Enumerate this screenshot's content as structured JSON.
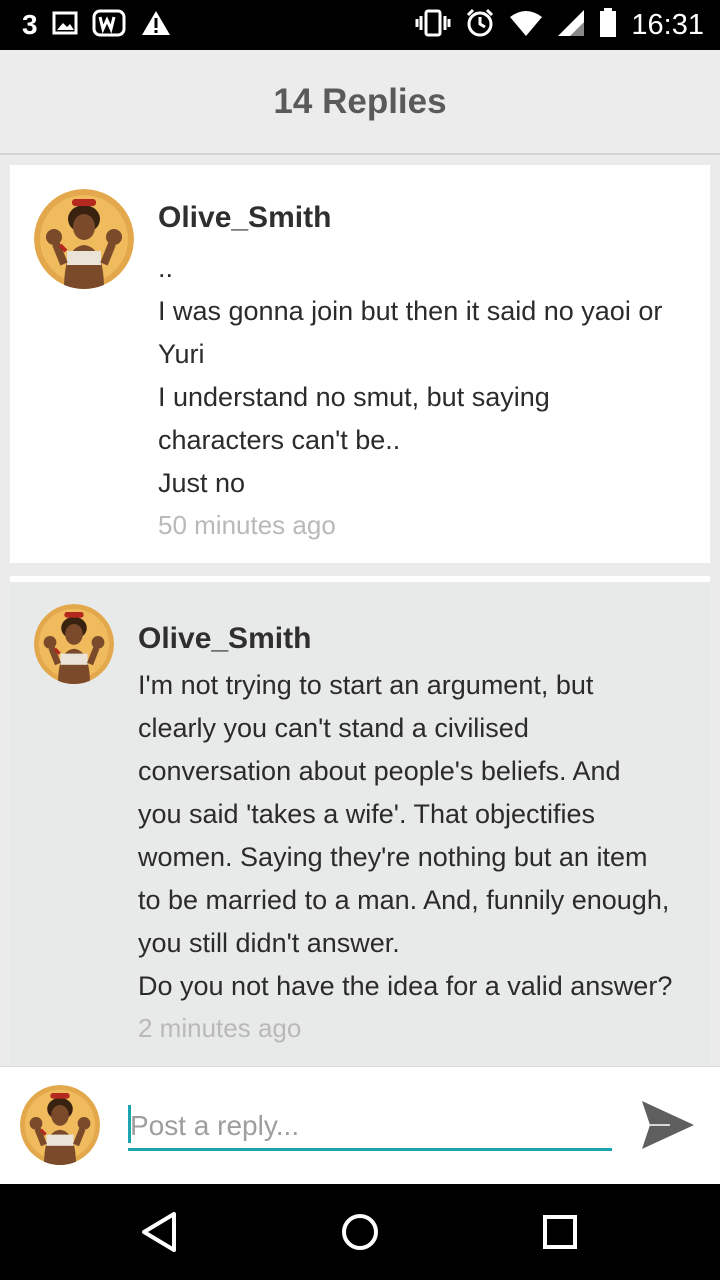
{
  "status_bar": {
    "notification_count": "3",
    "time": "16:31",
    "icons": [
      "image-icon",
      "w-app-icon",
      "warning-icon",
      "vibrate-icon",
      "alarm-icon",
      "wifi-icon",
      "signal-icon",
      "battery-icon"
    ]
  },
  "header": {
    "title": "14 Replies"
  },
  "replies": [
    {
      "username": "Olive_Smith",
      "lines": [
        "..",
        "I was gonna join but then it said no yaoi or",
        "Yuri",
        "I understand no smut, but saying",
        "characters can't be..",
        "Just no"
      ],
      "timestamp": "50 minutes ago"
    },
    {
      "username": "Olive_Smith",
      "lines": [
        "I'm not trying to start an argument, but",
        "clearly you can't stand a civilised",
        "conversation about people's beliefs. And",
        "you said 'takes a wife'. That objectifies",
        "women. Saying they're nothing but an item",
        "to be married to a man. And, funnily enough,",
        "you still didn't answer.",
        "Do you not have the idea for a valid answer?"
      ],
      "timestamp": "2 minutes ago"
    }
  ],
  "reply_bar": {
    "placeholder": "Post a reply..."
  },
  "colors": {
    "accent": "#1aa5b1",
    "header_bg": "#ececec",
    "reply_highlight_bg": "#e8e9e9"
  }
}
